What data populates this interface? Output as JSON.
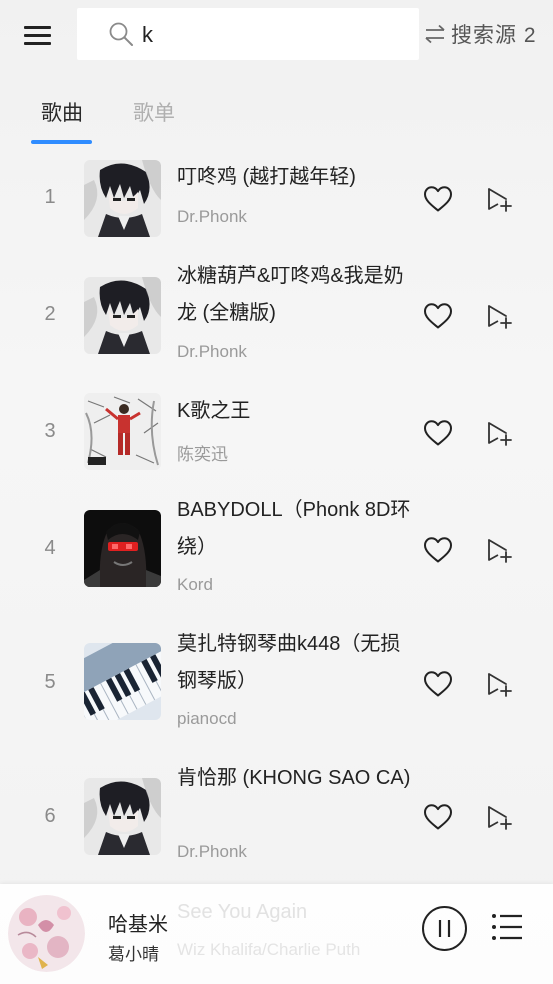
{
  "search": {
    "query": "k",
    "source_label": "搜索源 2"
  },
  "tabs": {
    "songs": "歌曲",
    "playlists": "歌单"
  },
  "songs": [
    {
      "index": "1",
      "title": "叮咚鸡 (越打越年轻)",
      "artist": "Dr.Phonk",
      "cover": "anime-boy"
    },
    {
      "index": "2",
      "title": "冰糖葫芦&叮咚鸡&我是奶龙 (全糖版)",
      "artist": "Dr.Phonk",
      "cover": "anime-boy"
    },
    {
      "index": "3",
      "title": "K歌之王",
      "artist": "陈奕迅",
      "cover": "sketch-figure"
    },
    {
      "index": "4",
      "title": "BABYDOLL（Phonk 8D环绕）",
      "artist": "Kord",
      "cover": "red-eyes"
    },
    {
      "index": "5",
      "title": "莫扎特钢琴曲k448（无损钢琴版）",
      "artist": "pianocd",
      "cover": "piano-keys"
    },
    {
      "index": "6",
      "title": "肯恰那 (KHONG SAO CA)",
      "artist": "Dr.Phonk",
      "cover": "anime-boy"
    }
  ],
  "player_background": {
    "title": "See You Again",
    "artist": "Wiz Khalifa/Charlie Puth"
  },
  "player": {
    "title": "哈基米",
    "artist": "葛小晴"
  },
  "colors": {
    "accent": "#2f8cff",
    "text": "#222222",
    "muted": "#9a9a9a"
  }
}
